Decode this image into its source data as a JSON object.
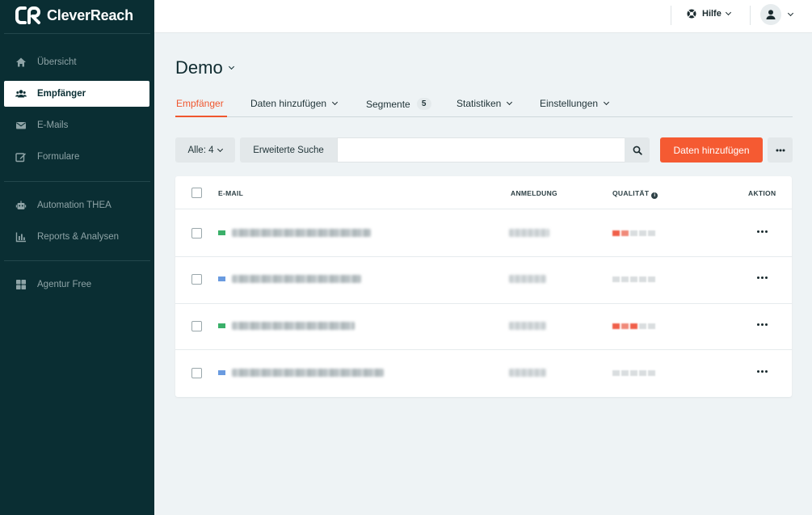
{
  "brand": {
    "name": "CleverReach",
    "accent": "#f55a32",
    "sidebar_bg": "#0a2e33"
  },
  "sidebar": {
    "items": [
      {
        "label": "Übersicht",
        "icon": "home-icon",
        "active": false
      },
      {
        "label": "Empfänger",
        "icon": "users-icon",
        "active": true
      },
      {
        "label": "E-Mails",
        "icon": "envelope-icon",
        "active": false
      },
      {
        "label": "Formulare",
        "icon": "edit-icon",
        "active": false
      },
      {
        "label": "Automation THEA",
        "icon": "robot-icon",
        "active": false
      },
      {
        "label": "Reports & Analysen",
        "icon": "bar-chart-icon",
        "active": false
      },
      {
        "label": "Agentur Free",
        "icon": "grid-icon",
        "active": false
      }
    ]
  },
  "topbar": {
    "help_label": "Hilfe",
    "help_icon": "life-ring-icon",
    "user_icon": "user-icon"
  },
  "page": {
    "title": "Demo"
  },
  "tabs": [
    {
      "label": "Empfänger",
      "active": true
    },
    {
      "label": "Daten hinzufügen",
      "dropdown": true
    },
    {
      "label": "Segmente",
      "count": "5"
    },
    {
      "label": "Statistiken",
      "dropdown": true
    },
    {
      "label": "Einstellungen",
      "dropdown": true
    }
  ],
  "toolbar": {
    "filter_label": "Alle: 4",
    "advanced_search_label": "Erweiterte Suche",
    "search_value": "",
    "add_data_label": "Daten hinzufügen",
    "more_icon": "ellipsis-icon"
  },
  "table": {
    "headers": {
      "email": "E-MAIL",
      "registration": "ANMELDUNG",
      "quality": "QUALITÄT",
      "action": "AKTION"
    },
    "rows": [
      {
        "status_color": "#3bb06a",
        "quality_colors": [
          "#f0604a",
          "#f08a7a",
          "#d9dddf",
          "#d9dddf",
          "#d9dddf"
        ]
      },
      {
        "status_color": "#6a9be0",
        "quality_colors": [
          "#d9dddf",
          "#d9dddf",
          "#d9dddf",
          "#d9dddf",
          "#d9dddf"
        ]
      },
      {
        "status_color": "#3bb06a",
        "quality_colors": [
          "#f0604a",
          "#f08a7a",
          "#f0604a",
          "#d9dddf",
          "#d9dddf"
        ]
      },
      {
        "status_color": "#6a9be0",
        "quality_colors": [
          "#d9dddf",
          "#d9dddf",
          "#d9dddf",
          "#d9dddf",
          "#d9dddf"
        ]
      }
    ]
  }
}
